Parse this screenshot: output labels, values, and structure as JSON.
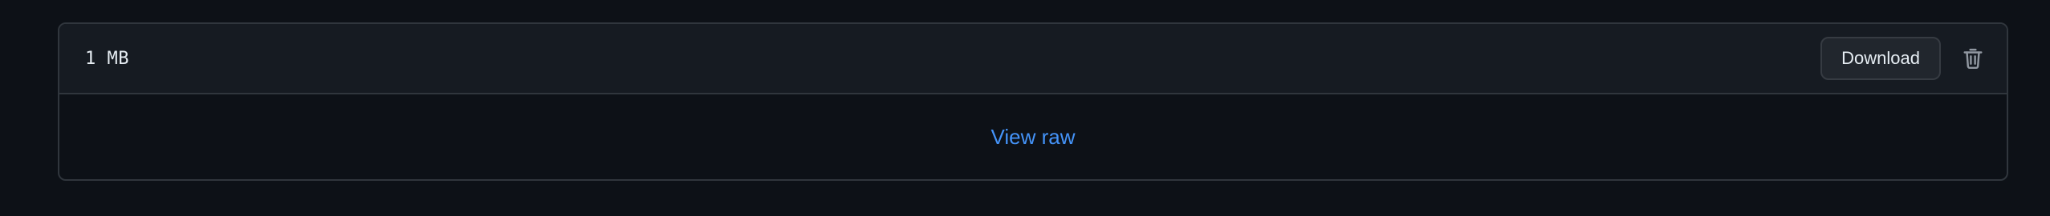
{
  "file": {
    "size": "1 MB",
    "download_label": "Download",
    "view_raw_label": "View raw"
  },
  "icons": {
    "delete": "trash-icon"
  },
  "colors": {
    "background": "#0d1117",
    "header_background": "#161b22",
    "border": "#30363d",
    "text": "#e6edf3",
    "link": "#4493f8",
    "icon": "#9198a1"
  }
}
